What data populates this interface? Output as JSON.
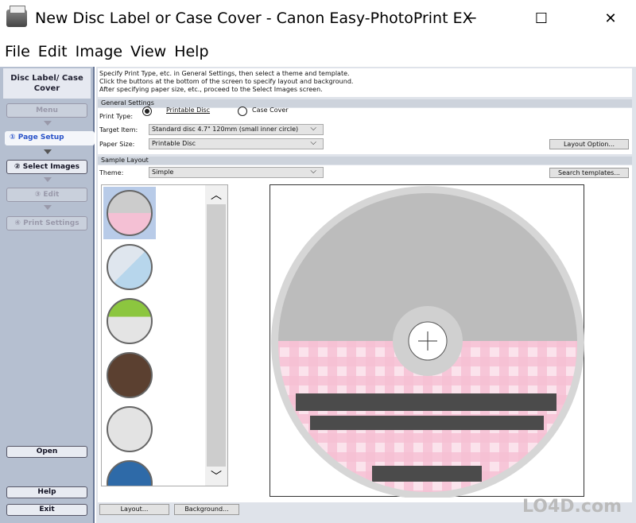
{
  "window": {
    "title": "New Disc Label or Case Cover - Canon Easy-PhotoPrint EX",
    "minimize": "─",
    "maximize": "☐",
    "close": "✕"
  },
  "menu": [
    "File",
    "Edit",
    "Image",
    "View",
    "Help"
  ],
  "sidebar": {
    "heading": "Disc Label/ Case Cover",
    "menu": "Menu",
    "steps": [
      "① Page Setup",
      "② Select Images",
      "③ Edit",
      "④ Print Settings"
    ],
    "open": "Open",
    "help": "Help",
    "exit": "Exit"
  },
  "instructions": [
    "Specify Print Type, etc. in General Settings, then select a theme and template.",
    "Click the buttons at the bottom of the screen to specify layout and background.",
    "After specifying paper size, etc., proceed to the Select Images screen."
  ],
  "general": {
    "title": "General Settings",
    "print_type_label": "Print Type:",
    "print_type_options": [
      "Printable Disc",
      "Case Cover"
    ],
    "print_type_selected": "Printable Disc",
    "target_label": "Target Item:",
    "target_value": "Standard disc 4.7\" 120mm (small inner circle)",
    "paper_label": "Paper Size:",
    "paper_value": "Printable Disc",
    "layout_option": "Layout Option..."
  },
  "sample": {
    "title": "Sample Layout",
    "theme_label": "Theme:",
    "theme_value": "Simple",
    "search": "Search templates..."
  },
  "footer": {
    "layout": "Layout...",
    "background": "Background..."
  },
  "colors": {
    "accent": "#2a53c8",
    "pink": "#f4b8d0",
    "disc_gray": "#bdbdbd"
  },
  "watermark": "LO4D.com"
}
